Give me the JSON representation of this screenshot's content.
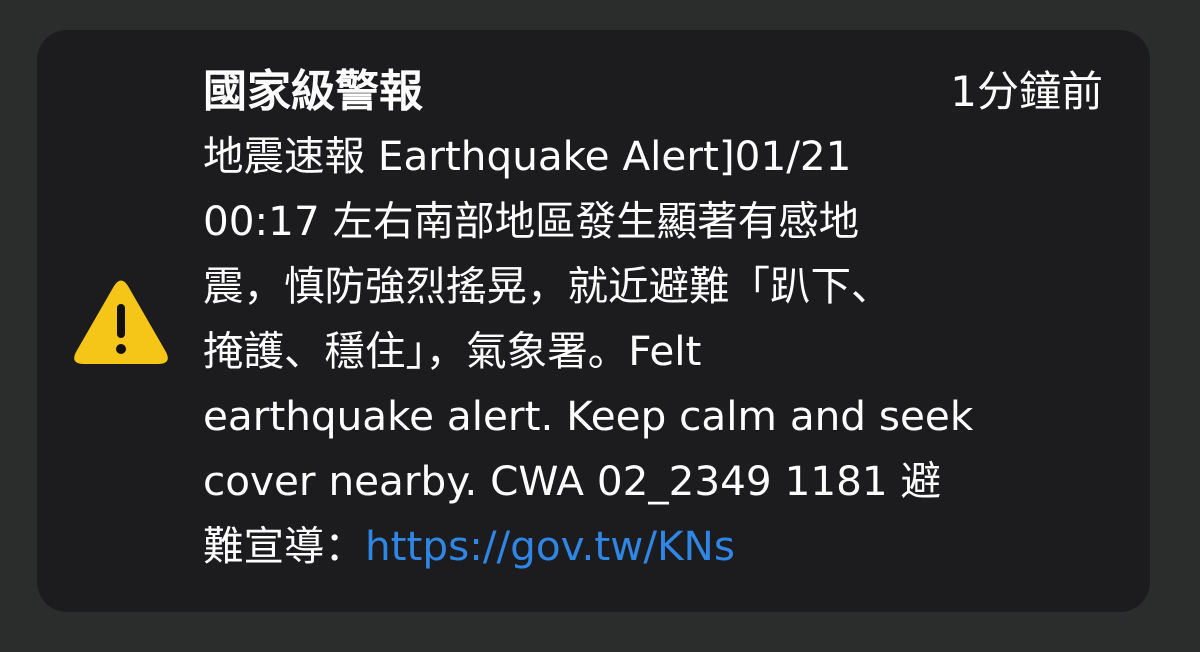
{
  "notification": {
    "title": "國家級警報",
    "time": "1分鐘前",
    "icon": "warning-triangle-icon",
    "accent_color": "#f5c518",
    "link_color": "#2f86e4",
    "body_lines": [
      "地震速報 Earthquake Alert]01/21",
      "00:17 左右南部地區發生顯著有感地",
      "震，慎防強烈搖晃，就近避難「趴下、",
      "掩護、穩住」，氣象署。Felt",
      "earthquake alert. Keep calm and seek",
      "cover nearby. CWA 02_2349 1181 避"
    ],
    "last_line_text": "難宣導：",
    "link_text": "https://gov.tw/KNs"
  }
}
